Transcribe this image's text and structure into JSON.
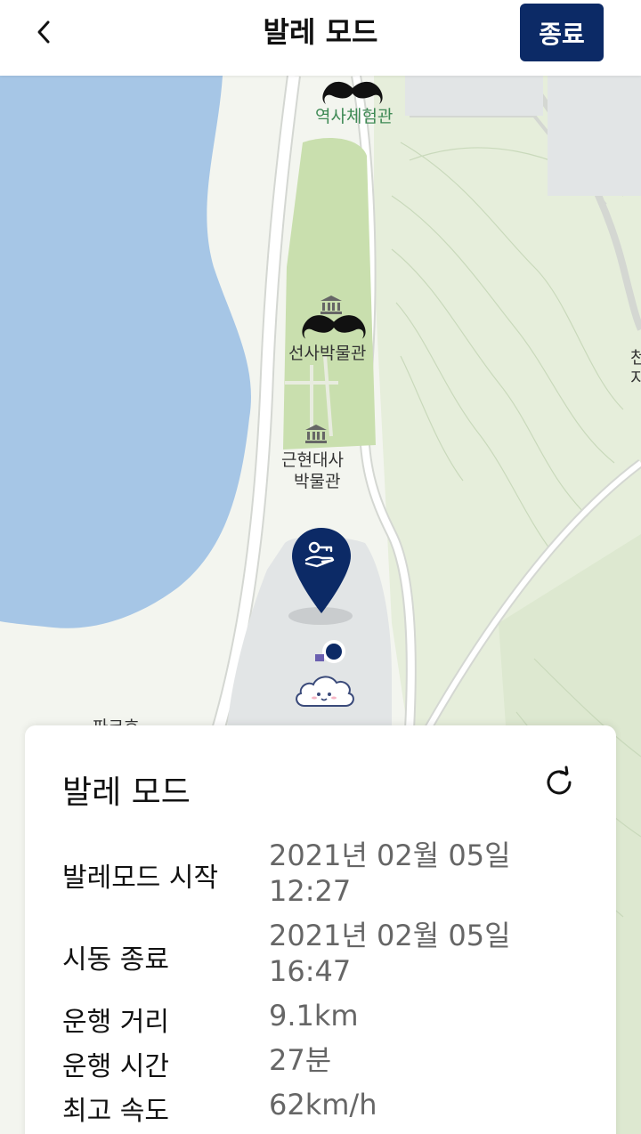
{
  "header": {
    "title": "발레 모드",
    "end_button_label": "종료",
    "back_icon": "chevron-left-icon"
  },
  "map": {
    "labels": {
      "history_hall": "역사체험관",
      "prehistory_museum": "선사박물관",
      "modern_museum_line1": "근현대사",
      "modern_museum_line2": "박물관",
      "partial_left": "파크호",
      "partial_right_1": "천",
      "partial_right_2": "지"
    },
    "colors": {
      "water": "#a6c6e6",
      "land": "#f3f5ef",
      "park": "#c9dfae",
      "forest": "#e3ecd8",
      "road": "#ffffff",
      "road_edge": "#d4d7d2",
      "building": "#e2e5e6",
      "pin": "#0c2a66"
    }
  },
  "card": {
    "title": "발레 모드",
    "rows": [
      {
        "label": "발레모드 시작",
        "value_line1": "2021년 02월 05일",
        "value_line2": "12:27"
      },
      {
        "label": "시동 종료",
        "value_line1": "2021년 02월 05일",
        "value_line2": "16:47"
      },
      {
        "label": "운행 거리",
        "value_line1": "9.1km"
      },
      {
        "label": "운행 시간",
        "value_line1": "27분"
      },
      {
        "label": "최고 속도",
        "value_line1": "62km/h"
      }
    ]
  }
}
